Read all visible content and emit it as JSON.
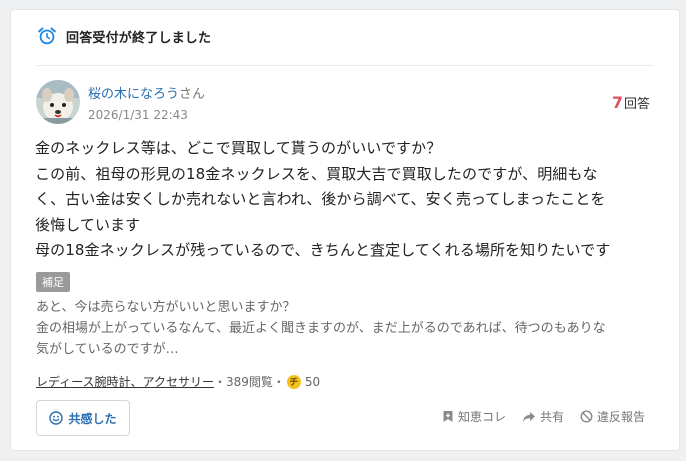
{
  "notice": {
    "text": "回答受付が終了しました",
    "icon": "alarm-clock-icon"
  },
  "question": {
    "author": {
      "name": "桜の木になろう",
      "suffix": "さん"
    },
    "date": "2026/1/31 22:43",
    "answer_count": {
      "number": "7",
      "label": "回答"
    },
    "lines": [
      "金のネックレス等は、どこで買取して貰うのがいいですか？",
      "この前、祖母の形見の18金ネックレスを、買取大吉で買取したのですが、明細もな",
      "く、古い金は安くしか売れないと言われ、後から調べて、安く売ってしまったことを",
      "後悔しています",
      "母の18金ネックレスが残っているので、きちんと査定してくれる場所を知りたいです"
    ]
  },
  "supplement": {
    "tag": "補足",
    "lines": [
      "あと、今は売らない方がいいと思いますか？",
      "金の相場が上がっているなんて、最近よく聞きますのが、まだ上がるのであれば、待つのもありな",
      "気がしているのですが…"
    ]
  },
  "meta": {
    "category": "レディース腕時計、アクセサリー",
    "sep1": "・",
    "views": "389閲覧",
    "sep2": "・",
    "coin_label": "チ",
    "coins": "50"
  },
  "actions": {
    "empathy": "共感した",
    "chie_kore": "知恵コレ",
    "share": "共有",
    "report": "違反報告"
  },
  "colors": {
    "link": "#2a6fb2",
    "answer_count": "#e0505e",
    "notice_icon": "#1e88e5",
    "coin": "#f4c21b"
  }
}
